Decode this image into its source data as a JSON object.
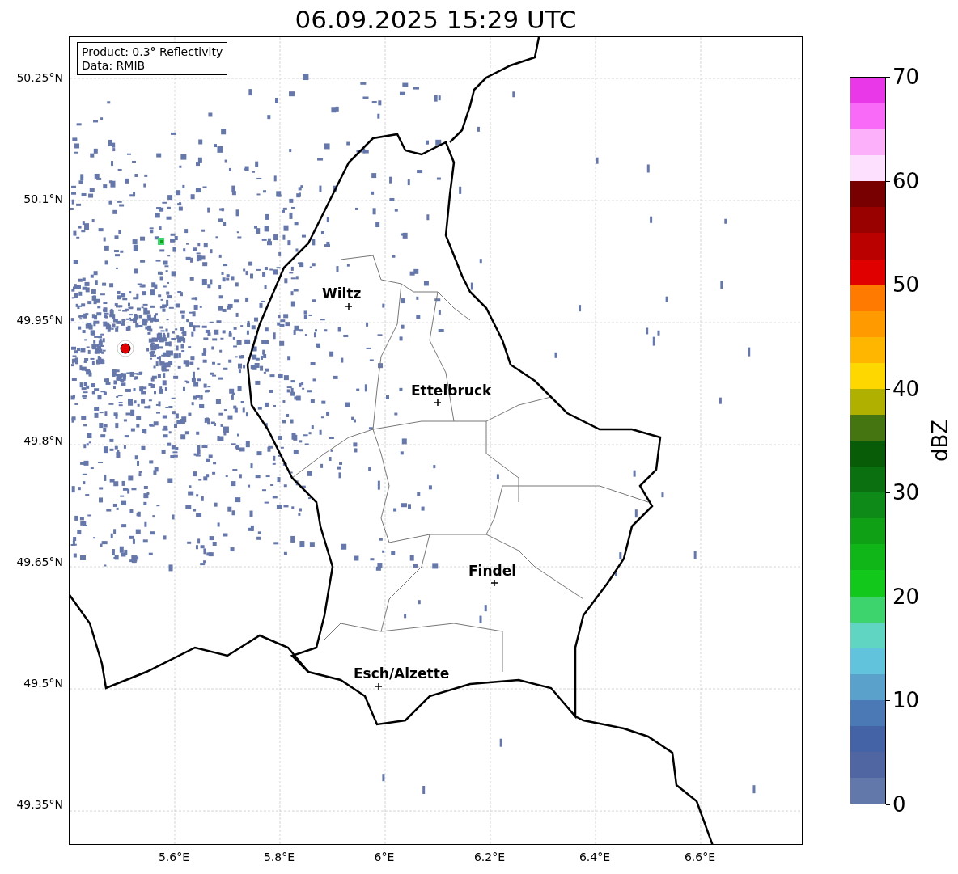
{
  "title": "06.09.2025 15:29 UTC",
  "legend": [
    "Product: 0.3° Reflectivity",
    "Data: RMIB"
  ],
  "y_ticks": [
    "50.25°N",
    "50.1°N",
    "49.95°N",
    "49.8°N",
    "49.65°N",
    "49.5°N",
    "49.35°N"
  ],
  "x_ticks": [
    "5.6°E",
    "5.8°E",
    "6°E",
    "6.2°E",
    "6.4°E",
    "6.6°E"
  ],
  "cities": [
    {
      "name": "Wiltz"
    },
    {
      "name": "Ettelbruck"
    },
    {
      "name": "Findel"
    },
    {
      "name": "Esch/Alzette"
    }
  ],
  "colorbar": {
    "label": "dBZ",
    "ticks": [
      "70",
      "60",
      "50",
      "40",
      "30",
      "20",
      "10",
      "0"
    ],
    "bins": [
      {
        "color": "#e838e8"
      },
      {
        "color": "#fa6af8"
      },
      {
        "color": "#fdb0fa"
      },
      {
        "color": "#fde0fd"
      },
      {
        "color": "#780000"
      },
      {
        "color": "#990000"
      },
      {
        "color": "#bb0000"
      },
      {
        "color": "#e00000"
      },
      {
        "color": "#ff7a00"
      },
      {
        "color": "#ff9a00"
      },
      {
        "color": "#ffb600"
      },
      {
        "color": "#ffd700"
      },
      {
        "color": "#b0b000"
      },
      {
        "color": "#457510"
      },
      {
        "color": "#085c08"
      },
      {
        "color": "#0a7010"
      },
      {
        "color": "#0d8a18"
      },
      {
        "color": "#10a015"
      },
      {
        "color": "#10b518"
      },
      {
        "color": "#12c81a"
      },
      {
        "color": "#3dd36d"
      },
      {
        "color": "#60d6c2"
      },
      {
        "color": "#62c3dc"
      },
      {
        "color": "#5aa1cc"
      },
      {
        "color": "#4a79b5"
      },
      {
        "color": "#4462a6"
      },
      {
        "color": "#4f66a3"
      },
      {
        "color": "#6277aa"
      }
    ]
  }
}
